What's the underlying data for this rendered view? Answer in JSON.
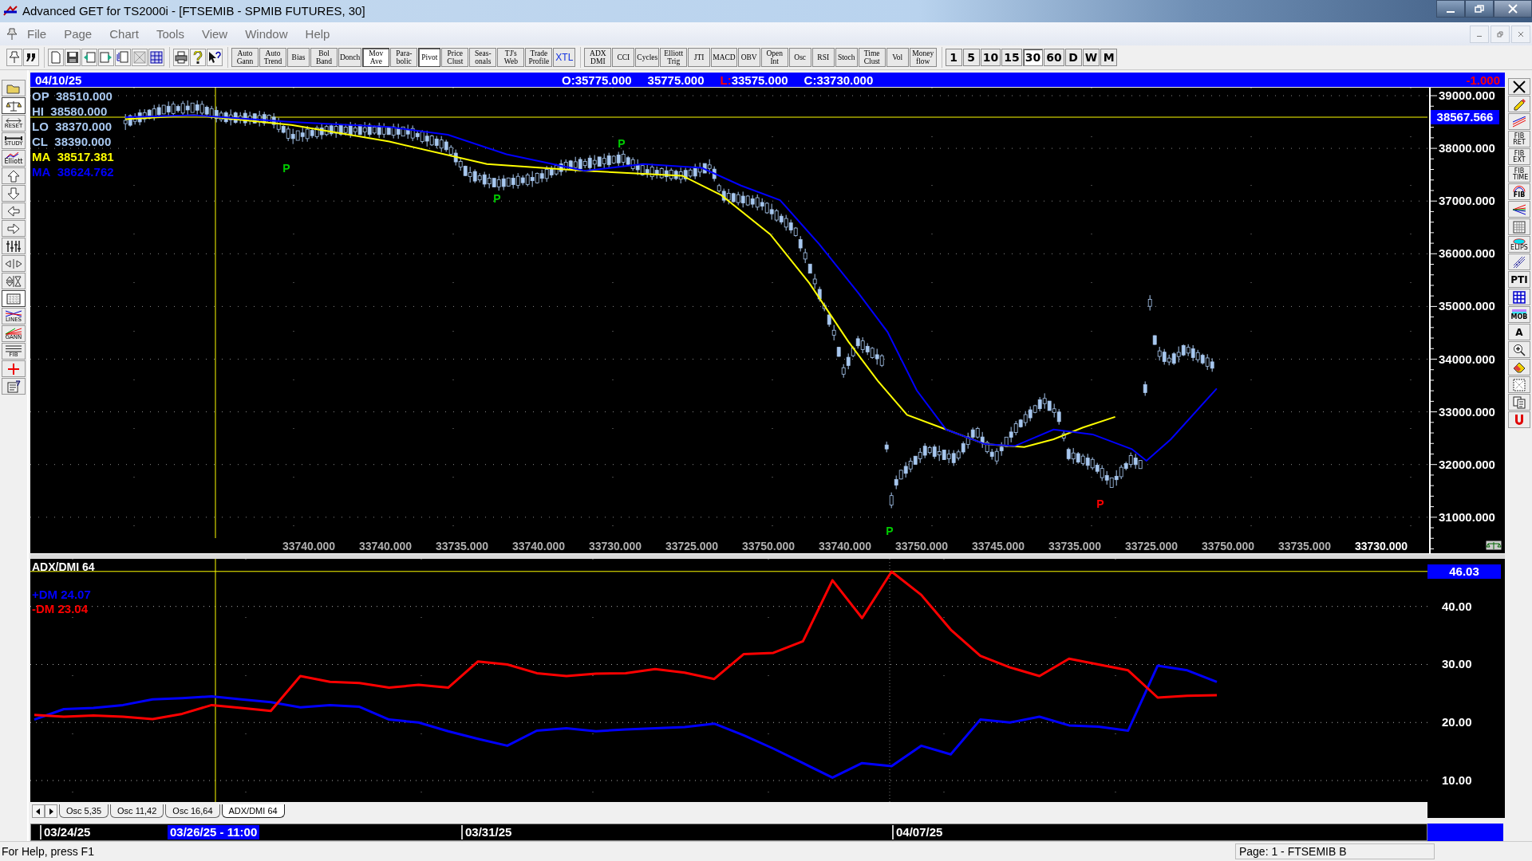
{
  "window": {
    "title": "Advanced GET for TS2000i - [FTSEMIB - SPMIB FUTURES, 30]"
  },
  "menu": [
    "File",
    "Page",
    "Chart",
    "Tools",
    "View",
    "Window",
    "Help"
  ],
  "study_buttons": [
    {
      "label": "Auto Gann",
      "selected": false
    },
    {
      "label": "Auto Trend",
      "selected": false
    },
    {
      "label": "Bias",
      "selected": false
    },
    {
      "label": "Bol Band",
      "selected": false
    },
    {
      "label": "Donch",
      "selected": false
    },
    {
      "label": "Mov Ave",
      "selected": true
    },
    {
      "label": "Para-bolic",
      "selected": false
    },
    {
      "label": "Pivot",
      "selected": true
    },
    {
      "label": "Price Clust",
      "selected": false
    },
    {
      "label": "Seas-onals",
      "selected": false
    },
    {
      "label": "TJ's Web",
      "selected": false
    },
    {
      "label": "Trade Profile",
      "selected": false
    },
    {
      "label": "XTL",
      "selected": false
    }
  ],
  "indicator_buttons": [
    {
      "label": "ADX DMI",
      "selected": false
    },
    {
      "label": "CCI",
      "selected": false
    },
    {
      "label": "Cycles",
      "selected": false
    },
    {
      "label": "Elliott Trig",
      "selected": false
    },
    {
      "label": "JTI",
      "selected": false
    },
    {
      "label": "MACD",
      "selected": false
    },
    {
      "label": "OBV",
      "selected": false
    },
    {
      "label": "Open Int",
      "selected": false
    },
    {
      "label": "Osc",
      "selected": false
    },
    {
      "label": "RSI",
      "selected": false
    },
    {
      "label": "Stoch",
      "selected": false
    },
    {
      "label": "Time Clust",
      "selected": false
    },
    {
      "label": "Vol",
      "selected": false
    },
    {
      "label": "Money flow",
      "selected": false
    }
  ],
  "interval_buttons": [
    {
      "label": "1",
      "selected": false
    },
    {
      "label": "5",
      "selected": false
    },
    {
      "label": "10",
      "selected": false
    },
    {
      "label": "15",
      "selected": false
    },
    {
      "label": "30",
      "selected": true
    },
    {
      "label": "60",
      "selected": false
    },
    {
      "label": "D",
      "selected": false
    },
    {
      "label": "W",
      "selected": false
    },
    {
      "label": "M",
      "selected": false
    }
  ],
  "left_toolbar": [
    {
      "kind": "open",
      "selected": false
    },
    {
      "kind": "balance",
      "selected": true
    },
    {
      "kind": "reset",
      "label": "RESET",
      "selected": false
    },
    {
      "kind": "study",
      "label": "STUDY",
      "selected": false
    },
    {
      "kind": "elliott",
      "label": "Elliott",
      "selected": false
    },
    {
      "kind": "up",
      "selected": false
    },
    {
      "kind": "down",
      "selected": false
    },
    {
      "kind": "left",
      "selected": false
    },
    {
      "kind": "right",
      "selected": false
    },
    {
      "kind": "vscale",
      "selected": false
    },
    {
      "kind": "hscale",
      "selected": false
    },
    {
      "kind": "vzoom",
      "selected": false
    },
    {
      "kind": "grid",
      "selected": true
    },
    {
      "kind": "lines",
      "label": "LINES",
      "selected": false
    },
    {
      "kind": "gann",
      "label": "GANN",
      "selected": false
    },
    {
      "kind": "fib",
      "label": "FIB",
      "selected": false
    },
    {
      "kind": "cross",
      "selected": false
    },
    {
      "kind": "props",
      "selected": false
    }
  ],
  "right_toolbar": [
    {
      "kind": "close"
    },
    {
      "kind": "pencil"
    },
    {
      "kind": "lines"
    },
    {
      "kind": "label",
      "label": "FIB RET"
    },
    {
      "kind": "label",
      "label": "FIB EXT"
    },
    {
      "kind": "label",
      "label": "FIB TIME"
    },
    {
      "kind": "arc",
      "label": "FIB"
    },
    {
      "kind": "fan"
    },
    {
      "kind": "grid"
    },
    {
      "kind": "ellipse",
      "label": "ELIPS"
    },
    {
      "kind": "pitch"
    },
    {
      "kind": "label",
      "label": "PTI"
    },
    {
      "kind": "table"
    },
    {
      "kind": "mob",
      "label": "MOB"
    },
    {
      "kind": "letter",
      "label": "A"
    },
    {
      "kind": "zoom"
    },
    {
      "kind": "eraser"
    },
    {
      "kind": "pattern"
    },
    {
      "kind": "copy"
    },
    {
      "kind": "magnet"
    }
  ],
  "info_bar": {
    "date": "04/10/25",
    "fields": [
      {
        "label": "O:",
        "value": "35775.000",
        "color": "#ffffff"
      },
      {
        "value": "35775.000"
      },
      {
        "label": "L:",
        "value": "33575.000",
        "color": "#ff0000"
      },
      {
        "label": "C:",
        "value": "33730.000",
        "color": "#ffffff"
      }
    ],
    "change": "-1.000"
  },
  "price_pane": {
    "legend": [
      {
        "label": "OP",
        "value": "38510.000",
        "color": "#a8c8f0"
      },
      {
        "label": "HI",
        "value": "38580.000",
        "color": "#a8c8f0"
      },
      {
        "label": "LO",
        "value": "38370.000",
        "color": "#a8c8f0"
      },
      {
        "label": "CL",
        "value": "38390.000",
        "color": "#a8c8f0"
      },
      {
        "label": "MA",
        "value": "38517.381",
        "color": "#ffff00"
      },
      {
        "label": "MA",
        "value": "38624.762",
        "color": "#0000ff"
      }
    ],
    "price_axis": [
      "39000.000",
      "38000.000",
      "37000.000",
      "36000.000",
      "35000.000",
      "34000.000",
      "33000.000",
      "32000.000",
      "31000.000"
    ],
    "cursor_price": "38567.566",
    "pivots": [
      {
        "label": "P",
        "color": "#00cc00"
      },
      {
        "label": "P",
        "color": "#00cc00"
      },
      {
        "label": "P",
        "color": "#00cc00"
      },
      {
        "label": "P",
        "color": "#00cc00"
      },
      {
        "label": "P",
        "color": "#ff0000"
      }
    ],
    "bar_values": [
      {
        "text": "33740.000",
        "current": false
      },
      {
        "text": "33740.000",
        "current": false
      },
      {
        "text": "33735.000",
        "current": false
      },
      {
        "text": "33740.000",
        "current": false
      },
      {
        "text": "33730.000",
        "current": false
      },
      {
        "text": "33725.000",
        "current": false
      },
      {
        "text": "33750.000",
        "current": false
      },
      {
        "text": "33740.000",
        "current": false
      },
      {
        "text": "33750.000",
        "current": false
      },
      {
        "text": "33745.000",
        "current": false
      },
      {
        "text": "33735.000",
        "current": false
      },
      {
        "text": "33725.000",
        "current": false
      },
      {
        "text": "33750.000",
        "current": false
      },
      {
        "text": "33735.000",
        "current": false
      },
      {
        "text": "33730.000",
        "current": true
      }
    ]
  },
  "indicator_pane": {
    "title": "ADX/DMI 64",
    "legend": [
      {
        "value": "24.07"
      },
      {
        "value": "23.04"
      }
    ],
    "adx_value": "46.03",
    "chart_data": {
      "type": "line",
      "ylim": [
        6.3,
        48.2
      ],
      "grid": true,
      "ref_lines": [
        {
          "axis": "y",
          "value": 46.03,
          "color": "#ffff00"
        }
      ],
      "yticks": [
        {
          "value": 10,
          "label": "10.00"
        },
        {
          "value": 20,
          "label": "20.00"
        },
        {
          "value": 30,
          "label": "30.00"
        },
        {
          "value": 40,
          "label": "40.00"
        }
      ],
      "series": [
        {
          "name": "+DM",
          "color": "#0000ff",
          "values": [
            20.5,
            22.3,
            22.5,
            23,
            24,
            24.2,
            24.5,
            24,
            23.5,
            22.6,
            23,
            22.7,
            20.5,
            20,
            18.5,
            17.2,
            16,
            18.6,
            19,
            18.5,
            18.8,
            19,
            19.2,
            19.8,
            17.8,
            15.5,
            13,
            10.5,
            13,
            12.5,
            16,
            14.5,
            20.5,
            20,
            21,
            19.5,
            19.3,
            18.6,
            29.8,
            29,
            27
          ]
        },
        {
          "name": "-DM",
          "color": "#ff0000",
          "values": [
            21.3,
            21,
            21.2,
            21,
            20.6,
            21.5,
            23,
            22.5,
            22,
            28,
            27,
            26.8,
            26,
            26.5,
            26,
            30.5,
            30,
            28.5,
            28,
            28.4,
            28.5,
            29.2,
            28.6,
            27.5,
            31.8,
            32,
            34,
            44.5,
            38,
            46,
            42,
            36,
            31.5,
            29.5,
            28,
            31,
            30,
            29,
            24.3,
            24.6,
            24.7
          ]
        }
      ]
    },
    "tabs": [
      {
        "label": "Osc 5,35",
        "selected": false
      },
      {
        "label": "Osc 11,42",
        "selected": false
      },
      {
        "label": "Osc 16,64",
        "selected": false
      },
      {
        "label": "ADX/DMI 64",
        "selected": true
      }
    ]
  },
  "date_bar": [
    {
      "text": "03/24/25",
      "selected": false
    },
    {
      "text": "03/26/25 - 11:00",
      "selected": true
    },
    {
      "text": "03/31/25",
      "selected": false
    },
    {
      "text": "04/07/25",
      "selected": false
    }
  ],
  "status_bar": {
    "help": "For Help, press F1",
    "page": "Page: 1 - FTSEMIB B"
  }
}
